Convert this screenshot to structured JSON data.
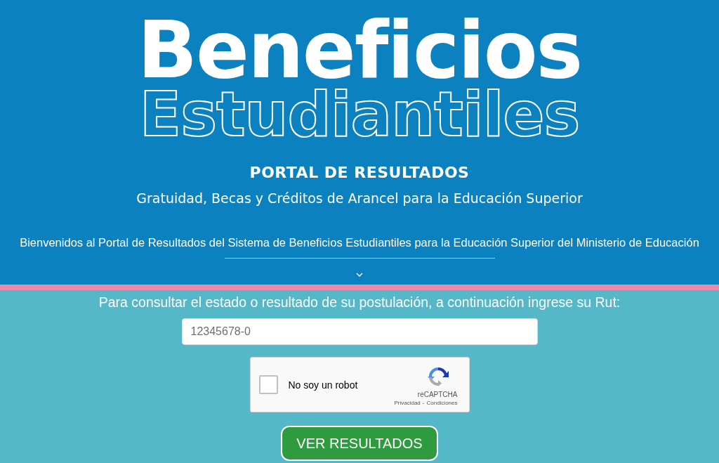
{
  "header": {
    "title": "Beneficios",
    "subtitle": "Estudiantiles",
    "portal_title": "PORTAL DE RESULTADOS",
    "tagline": "Gratuidad, Becas y Créditos de Arancel para la Educación Superior",
    "welcome": "Bienvenidos al Portal de Resultados del Sistema de Beneficios Estudiantiles para la Educación Superior del Ministerio de Educación"
  },
  "form": {
    "prompt": "Para consultar el estado o resultado de su postulación, a continuación ingrese su Rut:",
    "rut_field": {
      "placeholder": "12345678-0"
    },
    "captcha": {
      "label": "No soy un robot",
      "checked": false,
      "brand": "reCAPTCHA",
      "privacy_link": "Privacidad",
      "separator": "-",
      "terms_link": "Condiciones"
    },
    "submit_button": "VER RESULTADOS"
  }
}
